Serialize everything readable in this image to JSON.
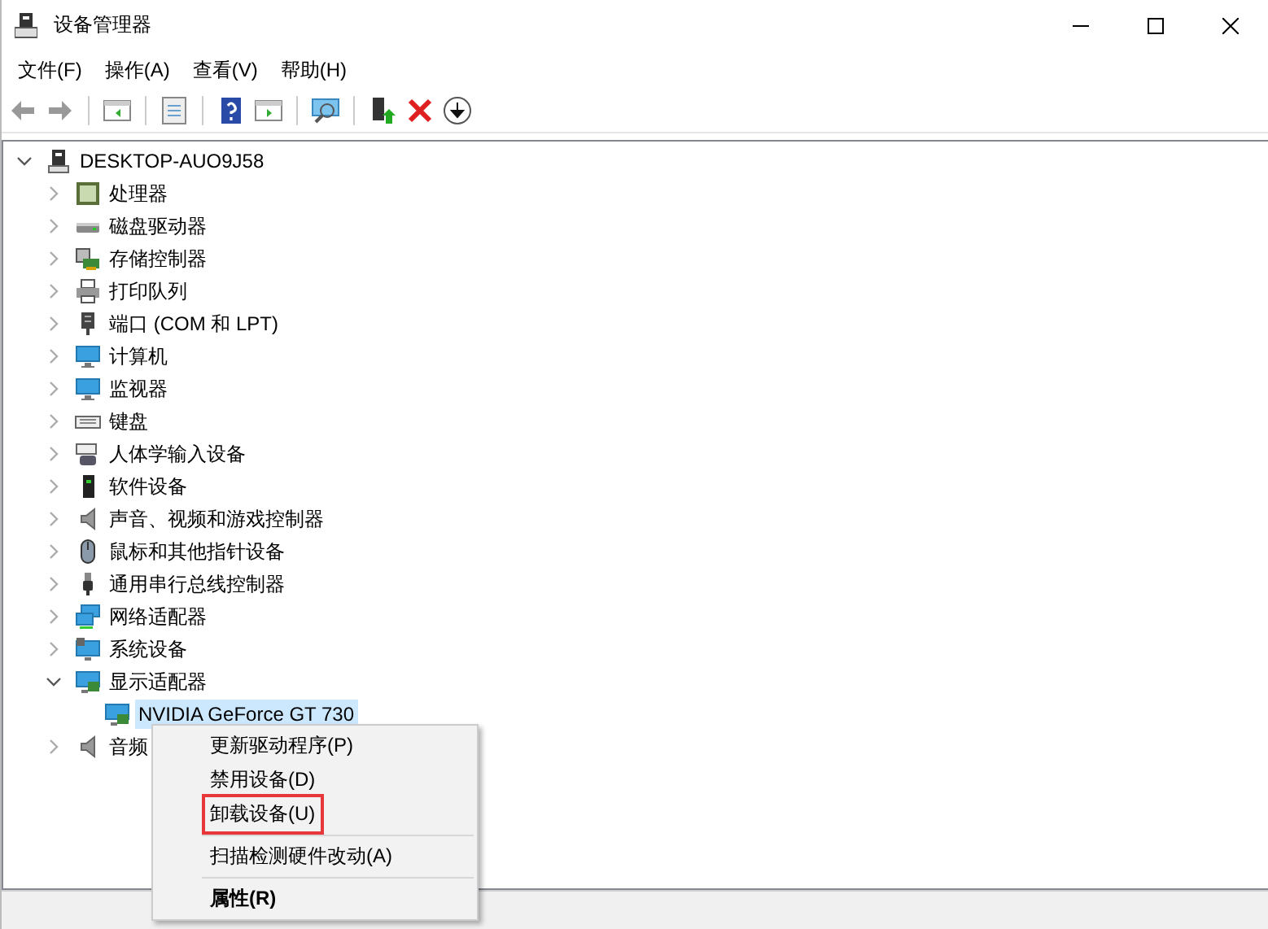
{
  "window": {
    "title": "设备管理器"
  },
  "menu_bar": [
    {
      "label": "文件(F)"
    },
    {
      "label": "操作(A)"
    },
    {
      "label": "查看(V)"
    },
    {
      "label": "帮助(H)"
    }
  ],
  "tree": {
    "label": "DESKTOP-AUO9J58",
    "expanded": true,
    "selected": false,
    "children": [
      {
        "label": "处理器",
        "expanded": false,
        "selected": false
      },
      {
        "label": "磁盘驱动器",
        "expanded": false,
        "selected": false
      },
      {
        "label": "存储控制器",
        "expanded": false,
        "selected": false
      },
      {
        "label": "打印队列",
        "expanded": false,
        "selected": false
      },
      {
        "label": "端口 (COM 和 LPT)",
        "expanded": false,
        "selected": false
      },
      {
        "label": "计算机",
        "expanded": false,
        "selected": false
      },
      {
        "label": "监视器",
        "expanded": false,
        "selected": false
      },
      {
        "label": "键盘",
        "expanded": false,
        "selected": false
      },
      {
        "label": "人体学输入设备",
        "expanded": false,
        "selected": false
      },
      {
        "label": "软件设备",
        "expanded": false,
        "selected": false
      },
      {
        "label": "声音、视频和游戏控制器",
        "expanded": false,
        "selected": false
      },
      {
        "label": "鼠标和其他指针设备",
        "expanded": false,
        "selected": false
      },
      {
        "label": "通用串行总线控制器",
        "expanded": false,
        "selected": false
      },
      {
        "label": "网络适配器",
        "expanded": false,
        "selected": false
      },
      {
        "label": "系统设备",
        "expanded": false,
        "selected": false
      },
      {
        "label": "显示适配器",
        "expanded": true,
        "selected": false,
        "children": [
          {
            "label": "NVIDIA GeForce GT 730",
            "selected": true
          }
        ]
      },
      {
        "label": "音频",
        "expanded": false,
        "selected": false
      }
    ]
  },
  "context_menu": [
    {
      "kind": "item",
      "label": "更新驱动程序(P)",
      "outlined": false,
      "default": false
    },
    {
      "kind": "item",
      "label": "禁用设备(D)",
      "outlined": false,
      "default": false
    },
    {
      "kind": "item",
      "label": "卸载设备(U)",
      "outlined": true,
      "default": false
    },
    {
      "kind": "separator"
    },
    {
      "kind": "item",
      "label": "扫描检测硬件改动(A)",
      "outlined": false,
      "default": false
    },
    {
      "kind": "separator"
    },
    {
      "kind": "item",
      "label": "属性(R)",
      "outlined": false,
      "default": true
    }
  ]
}
